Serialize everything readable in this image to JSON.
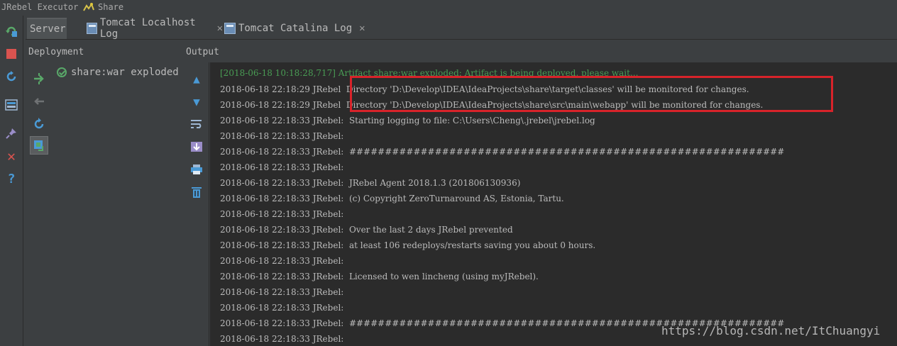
{
  "titlebar": {
    "app": "JRebel Executor",
    "config": "Share"
  },
  "tabs": [
    {
      "label": "Server"
    },
    {
      "label": "Tomcat Localhost Log"
    },
    {
      "label": "Tomcat Catalina Log"
    }
  ],
  "panels": {
    "deployment": "Deployment",
    "output": "Output"
  },
  "deployment": {
    "item": "share:war exploded"
  },
  "console": {
    "lines": [
      "[2018-06-18 10:18:28,717] Artifact share:war exploded: Artifact is being deployed, please wait...",
      "2018-06-18 22:18:29 JRebel  Directory 'D:\\Develop\\IDEA\\IdeaProjects\\share\\target\\classes' will be monitored for changes.",
      "2018-06-18 22:18:29 JRebel  Directory 'D:\\Develop\\IDEA\\IdeaProjects\\share\\src\\main\\webapp' will be monitored for changes.",
      "2018-06-18 22:18:33 JRebel:  Starting logging to file: C:\\Users\\Cheng\\.jrebel\\jrebel.log",
      "2018-06-18 22:18:33 JRebel:",
      "2018-06-18 22:18:33 JRebel:  #############################################################",
      "2018-06-18 22:18:33 JRebel:",
      "2018-06-18 22:18:33 JRebel:  JRebel Agent 2018.1.3 (201806130936)",
      "2018-06-18 22:18:33 JRebel:  (c) Copyright ZeroTurnaround AS, Estonia, Tartu.",
      "2018-06-18 22:18:33 JRebel:",
      "2018-06-18 22:18:33 JRebel:  Over the last 2 days JRebel prevented",
      "2018-06-18 22:18:33 JRebel:  at least 106 redeploys/restarts saving you about 0 hours.",
      "2018-06-18 22:18:33 JRebel:",
      "2018-06-18 22:18:33 JRebel:  Licensed to wen lincheng (using myJRebel).",
      "2018-06-18 22:18:33 JRebel:",
      "2018-06-18 22:18:33 JRebel:",
      "2018-06-18 22:18:33 JRebel:  #############################################################",
      "2018-06-18 22:18:33 JRebel:"
    ]
  },
  "watermark": "https://blog.csdn.net/ItChuangyi",
  "colors": {
    "background": "#3c3f41",
    "console": "#2b2b2b",
    "green": "#499c54",
    "highlight": "#d8232a"
  },
  "icons": {
    "leftbar": [
      "rerun-icon",
      "stop-icon",
      "update-icon",
      "layout-icon",
      "pin-icon",
      "close-icon",
      "help-icon"
    ],
    "deployment_tools": [
      "deploy-icon",
      "undeploy-icon",
      "redeploy-icon",
      "artifact-icon"
    ],
    "output_tools": [
      "scroll-up-icon",
      "scroll-down-icon",
      "soft-wrap-icon",
      "scroll-to-end-icon",
      "print-icon",
      "clear-icon"
    ]
  }
}
